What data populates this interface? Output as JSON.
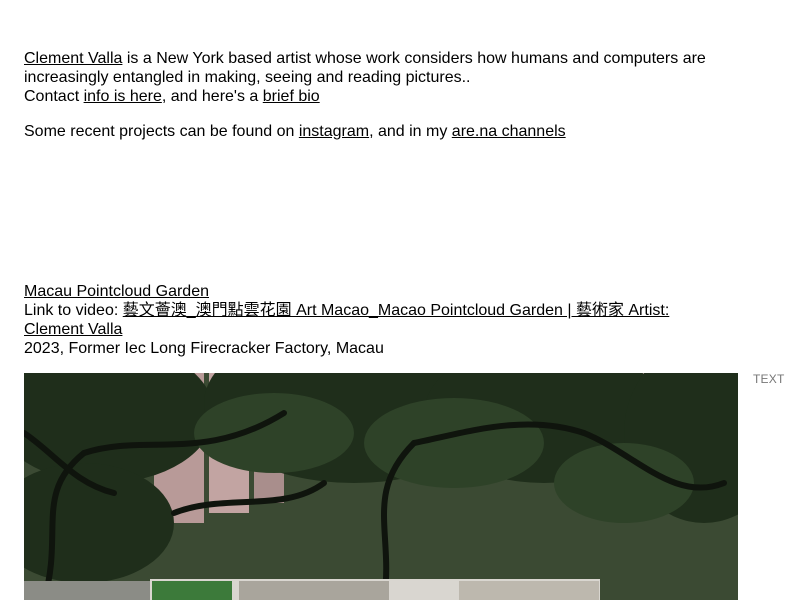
{
  "intro": {
    "artist_link": "Clement Valla",
    "bio_text": " is a New York based artist whose work considers how humans and computers are increasingly entangled in making, seeing and reading pictures..",
    "contact_prefix": "Contact ",
    "info_link": "info is here",
    "contact_middle": ", and here's a ",
    "bio_link": "brief bio"
  },
  "recent": {
    "prefix": "Some recent projects can be found on ",
    "instagram_link": "instagram",
    "middle": ", and in my ",
    "arena_link": "are.na channels"
  },
  "project": {
    "title_link": "Macau Pointcloud Garden",
    "video_prefix": "Link to video: ",
    "video_link": "藝文薈澳_澳門點雲花園 Art Macao_Macao Pointcloud Garden | 藝術家 Artist: Clement Valla",
    "details": "2023, Former Iec Long Firecracker Factory, Macau",
    "image_icon": "project-photo"
  },
  "side": {
    "label": "TEXT"
  }
}
